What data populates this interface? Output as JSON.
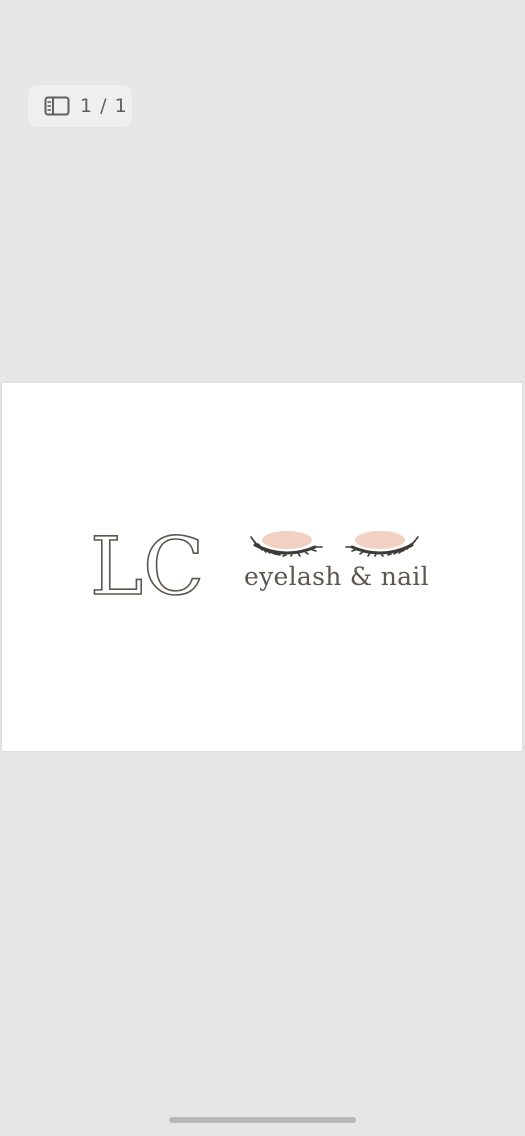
{
  "viewer": {
    "page_indicator": "1 / 1",
    "page_indicator_icon": "document-pages-icon"
  },
  "document": {
    "logo": {
      "monogram": "LC",
      "tagline": "eyelash & nail",
      "icon": "closed-eyelashes-icon",
      "colors": {
        "text": "#5b5650",
        "eyeshadow": "#f0c9b7",
        "lashes": "#3e3a36"
      }
    }
  }
}
